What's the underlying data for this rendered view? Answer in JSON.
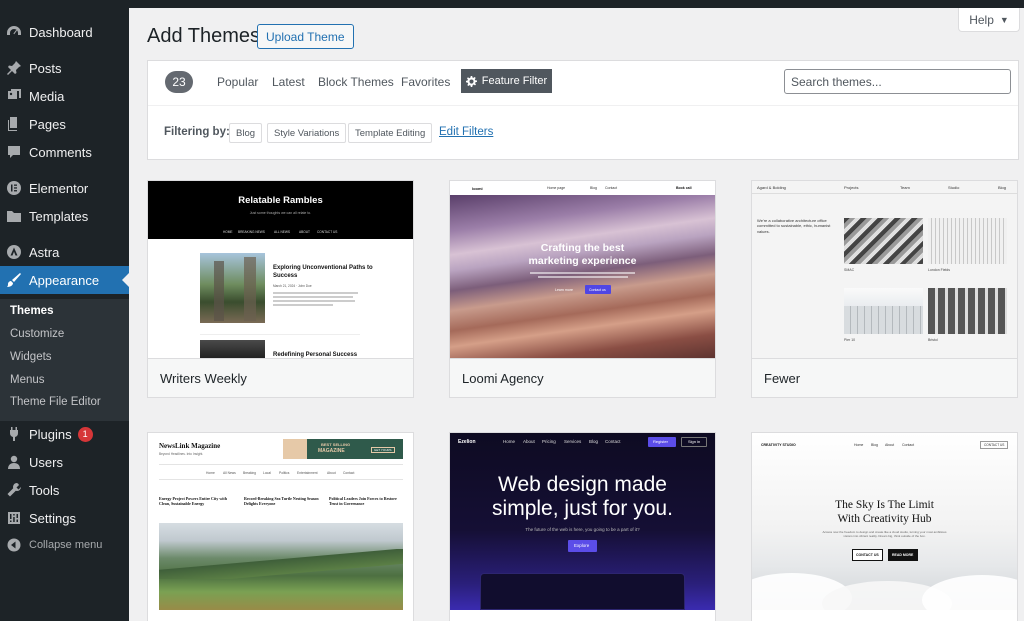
{
  "sidebar": {
    "dashboard": "Dashboard",
    "posts": "Posts",
    "media": "Media",
    "pages": "Pages",
    "comments": "Comments",
    "elementor": "Elementor",
    "templates": "Templates",
    "astra": "Astra",
    "appearance": "Appearance",
    "submenu": {
      "themes": "Themes",
      "customize": "Customize",
      "widgets": "Widgets",
      "menus": "Menus",
      "theme_file_editor": "Theme File Editor"
    },
    "plugins": "Plugins",
    "plugins_badge": "1",
    "users": "Users",
    "tools": "Tools",
    "settings": "Settings",
    "collapse": "Collapse menu"
  },
  "header": {
    "title": "Add Themes",
    "upload_label": "Upload Theme",
    "help_label": "Help"
  },
  "filterbar": {
    "count": "23",
    "tabs": [
      "Popular",
      "Latest",
      "Block Themes",
      "Favorites"
    ],
    "feature_filter": "Feature Filter",
    "search_placeholder": "Search themes...",
    "filtering_by": "Filtering by:",
    "chips": [
      "Blog",
      "Style Variations",
      "Template Editing"
    ],
    "edit_filters": "Edit Filters"
  },
  "themes": {
    "writers_weekly": {
      "name": "Writers Weekly",
      "site_title": "Relatable Rambles",
      "tagline": "Just some thoughts we can all relate to.",
      "nav": [
        "HOME",
        "BREAKING NEWS",
        "ALL NEWS",
        "ABOUT",
        "CONTACT US"
      ],
      "post1_title": "Exploring Unconventional Paths to Success",
      "post1_meta": "March 21, 2024  ·  John Doe",
      "post2_title": "Redefining Personal Success"
    },
    "loomi": {
      "name": "Loomi Agency",
      "logo": "loomi",
      "nav": [
        "Home page",
        "Blog",
        "Contact"
      ],
      "cta_top": "Book call",
      "hero_line1": "Crafting the best",
      "hero_line2": "marketing experience",
      "btn1": "Learn more",
      "btn2": "Contact us"
    },
    "fewer": {
      "name": "Fewer",
      "brand": "Agard & Bolding",
      "nav": [
        "Projects",
        "Team",
        "Studio",
        "Blog"
      ],
      "intro": "We're a collaborative architecture office committed to sustainable, ethic, humanist values.",
      "labels": [
        "SMAC",
        "London Fields",
        "Pier 10",
        "Bristol"
      ]
    },
    "newslink": {
      "name_title": "NewsLink Magazine",
      "tagline": "Beyond Headlines. Into Insight.",
      "ad_line1": "BEST SELLING",
      "ad_line2": "MAGAZINE",
      "ad_btn": "GET YOURS",
      "nav": [
        "Home",
        "All News",
        "Breaking",
        "Local",
        "Politics",
        "Entertainment",
        "About",
        "Contact"
      ],
      "headlines": [
        "Energy Project Powers Entire City with Clean, Sustainable Energy",
        "Record-Breaking Sea Turtle Nesting Season Delights Everyone",
        "Political Leaders Join Forces to Restore Trust in Governance"
      ]
    },
    "ezelion": {
      "logo": "Ezelion",
      "nav": [
        "Home",
        "About",
        "Pricing",
        "Services",
        "Blog",
        "Contact"
      ],
      "register": "Register",
      "signin": "Sign in",
      "hero_line1": "Web design made",
      "hero_line2": "simple, just for you.",
      "sub": "The future of the web is here, you going to be a part of it?",
      "btn": "Explore"
    },
    "creativity": {
      "logo": "CREATIVITY STUDIO",
      "nav": [
        "Home",
        "Blog",
        "About",
        "Contact"
      ],
      "contact_btn": "CONTACT US",
      "hero_line1": "The Sky Is The Limit",
      "hero_line2": "With Creativity Hub",
      "sub": "Access now the freedom to design and create like a cloud studio, turning your most ambitious visions into vibrant reality. Dream big, think outside of the box.",
      "btn1": "CONTACT US",
      "btn2": "READ MORE"
    }
  },
  "colors": {
    "sidebar_bg": "#1d2327",
    "accent": "#2271b1",
    "badge": "#d63638",
    "loomi_button": "#4f46e5",
    "ezelion_accent": "#5b4de8"
  }
}
